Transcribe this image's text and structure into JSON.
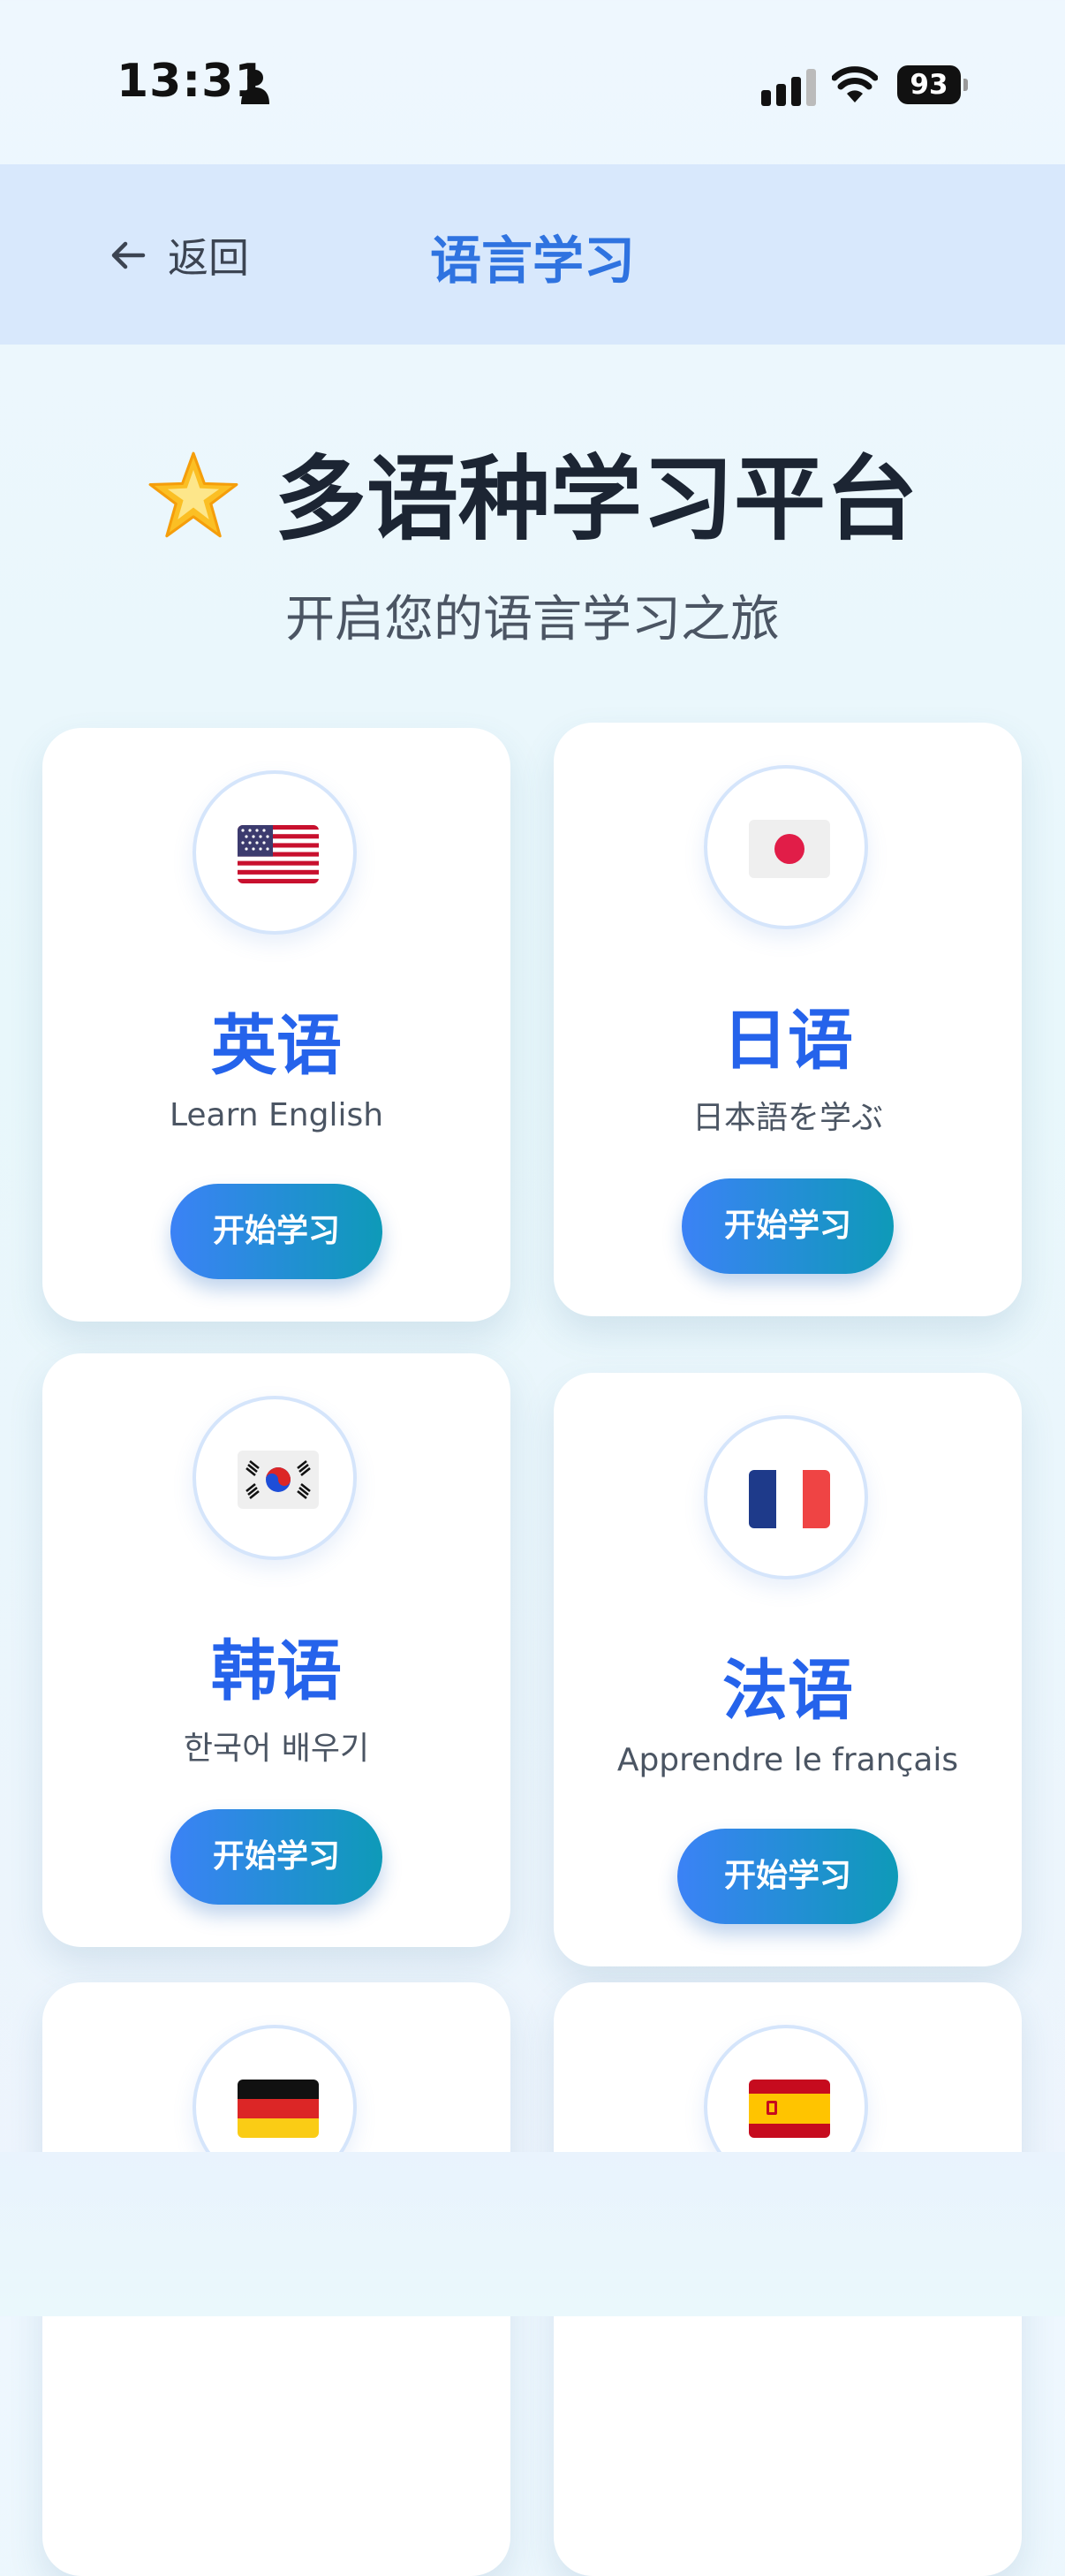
{
  "status_bar": {
    "time": "13:31",
    "battery": "93"
  },
  "nav": {
    "back_label": "返回",
    "title": "语言学习"
  },
  "hero": {
    "title": "多语种学习平台",
    "subtitle": "开启您的语言学习之旅"
  },
  "cards": [
    {
      "name": "英语",
      "subtitle": "Learn English",
      "button": "开始学习",
      "flag": "us-flag-icon"
    },
    {
      "name": "日语",
      "subtitle": "日本語を学ぶ",
      "button": "开始学习",
      "flag": "japan-flag-icon"
    },
    {
      "name": "韩语",
      "subtitle": "한국어 배우기",
      "button": "开始学习",
      "flag": "korea-flag-icon"
    },
    {
      "name": "法语",
      "subtitle": "Apprendre le français",
      "button": "开始学习",
      "flag": "france-flag-icon"
    },
    {
      "name": "",
      "subtitle": "",
      "button": "",
      "flag": "germany-flag-icon"
    },
    {
      "name": "",
      "subtitle": "",
      "button": "",
      "flag": "spain-flag-icon"
    }
  ],
  "colors": {
    "accent": "#2563eb",
    "nav_bg": "#d8e8fc",
    "button_start": "#3b82f6",
    "button_end": "#0e9ab8"
  }
}
